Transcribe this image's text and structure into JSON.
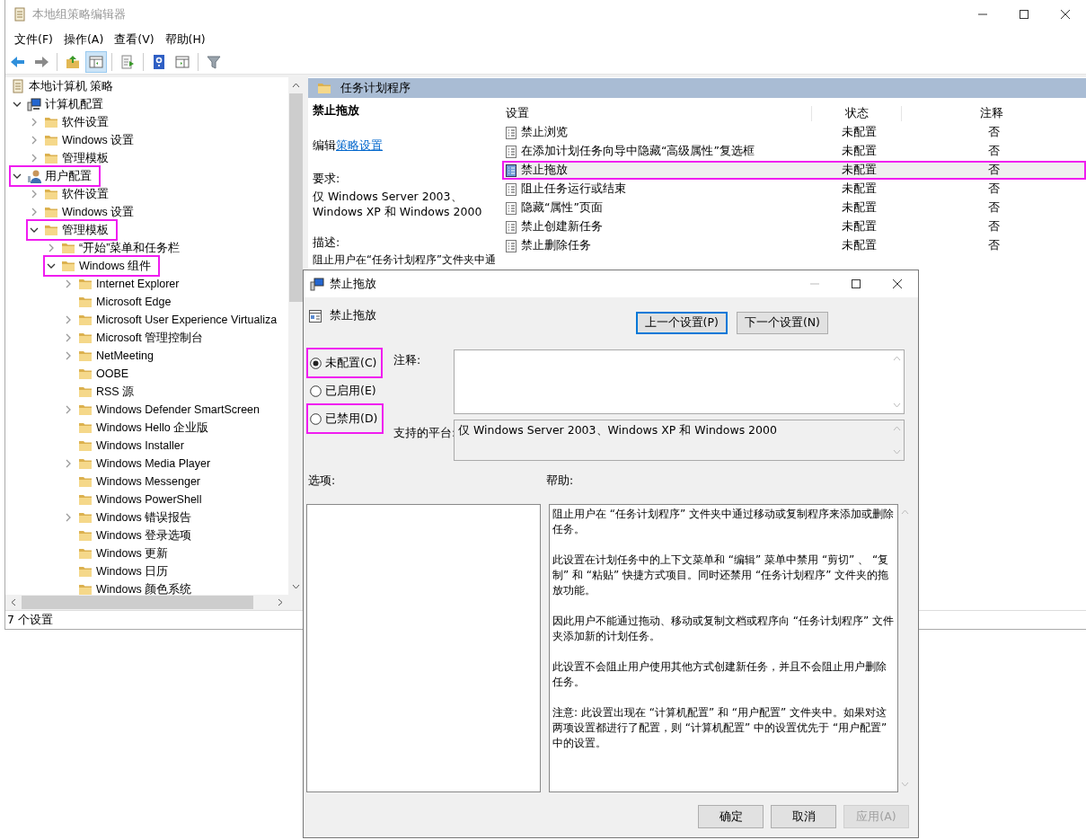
{
  "window": {
    "title": "本地组策略编辑器"
  },
  "menu": [
    "文件(F)",
    "操作(A)",
    "查看(V)",
    "帮助(H)"
  ],
  "toolbar": [
    [
      {
        "kind": "back",
        "pressed": false
      },
      {
        "kind": "forward",
        "pressed": false
      }
    ],
    [
      {
        "kind": "up",
        "pressed": false
      },
      {
        "kind": "tree",
        "pressed": true
      }
    ],
    [
      {
        "kind": "export",
        "pressed": false
      }
    ],
    [
      {
        "kind": "help",
        "pressed": false
      },
      {
        "kind": "view",
        "pressed": false
      }
    ],
    [
      {
        "kind": "filter",
        "pressed": false
      }
    ]
  ],
  "tree": {
    "label": "本地计算机 策略",
    "children": [
      {
        "label": "计算机配置",
        "kind": "computer",
        "expandable": true,
        "expanded": true,
        "highlighted": false,
        "children": [
          {
            "label": "软件设置",
            "kind": "folder",
            "expandable": true,
            "expanded": false,
            "highlighted": false
          },
          {
            "label": "Windows 设置",
            "kind": "folder",
            "expandable": true,
            "expanded": false,
            "highlighted": false
          },
          {
            "label": "管理模板",
            "kind": "folder",
            "expandable": true,
            "expanded": false,
            "highlighted": false
          }
        ]
      },
      {
        "label": "用户配置",
        "kind": "user",
        "expandable": true,
        "expanded": true,
        "highlighted": true,
        "children": [
          {
            "label": "软件设置",
            "kind": "folder",
            "expandable": true,
            "expanded": false,
            "highlighted": false
          },
          {
            "label": "Windows 设置",
            "kind": "folder",
            "expandable": true,
            "expanded": false,
            "highlighted": false
          },
          {
            "label": "管理模板",
            "kind": "folder",
            "expandable": true,
            "expanded": true,
            "highlighted": true,
            "children": [
              {
                "label": "“开始”菜单和任务栏",
                "kind": "folder",
                "expandable": true,
                "expanded": false,
                "highlighted": false
              },
              {
                "label": "Windows 组件",
                "kind": "folder",
                "expandable": true,
                "expanded": true,
                "highlighted": true,
                "children": [
                  {
                    "label": "Internet Explorer",
                    "kind": "folder",
                    "expandable": true,
                    "expanded": false,
                    "highlighted": false
                  },
                  {
                    "label": "Microsoft Edge",
                    "kind": "folder",
                    "expandable": false,
                    "highlighted": false
                  },
                  {
                    "label": "Microsoft User Experience Virtualiza",
                    "kind": "folder",
                    "expandable": true,
                    "expanded": false,
                    "highlighted": false
                  },
                  {
                    "label": "Microsoft 管理控制台",
                    "kind": "folder",
                    "expandable": true,
                    "expanded": false,
                    "highlighted": false
                  },
                  {
                    "label": "NetMeeting",
                    "kind": "folder",
                    "expandable": true,
                    "expanded": false,
                    "highlighted": false
                  },
                  {
                    "label": "OOBE",
                    "kind": "folder",
                    "expandable": false,
                    "highlighted": false
                  },
                  {
                    "label": "RSS 源",
                    "kind": "folder",
                    "expandable": false,
                    "highlighted": false
                  },
                  {
                    "label": "Windows Defender SmartScreen",
                    "kind": "folder",
                    "expandable": true,
                    "expanded": false,
                    "highlighted": false
                  },
                  {
                    "label": "Windows Hello 企业版",
                    "kind": "folder",
                    "expandable": false,
                    "highlighted": false
                  },
                  {
                    "label": "Windows Installer",
                    "kind": "folder",
                    "expandable": false,
                    "highlighted": false
                  },
                  {
                    "label": "Windows Media Player",
                    "kind": "folder",
                    "expandable": true,
                    "expanded": false,
                    "highlighted": false
                  },
                  {
                    "label": "Windows Messenger",
                    "kind": "folder",
                    "expandable": false,
                    "highlighted": false
                  },
                  {
                    "label": "Windows PowerShell",
                    "kind": "folder",
                    "expandable": false,
                    "highlighted": false
                  },
                  {
                    "label": "Windows 错误报告",
                    "kind": "folder",
                    "expandable": true,
                    "expanded": false,
                    "highlighted": false
                  },
                  {
                    "label": "Windows 登录选项",
                    "kind": "folder",
                    "expandable": false,
                    "highlighted": false
                  },
                  {
                    "label": "Windows 更新",
                    "kind": "folder",
                    "expandable": false,
                    "highlighted": false
                  },
                  {
                    "label": "Windows 日历",
                    "kind": "folder",
                    "expandable": false,
                    "highlighted": false
                  },
                  {
                    "label": "Windows 颜色系统",
                    "kind": "folder",
                    "expandable": false,
                    "highlighted": false
                  }
                ]
              }
            ]
          }
        ]
      }
    ]
  },
  "pane": {
    "header": "任务计划程序",
    "detail": {
      "title": "禁止拖放",
      "edit_prefix": "编辑",
      "edit_link": "策略设置",
      "requirements_label": "要求:",
      "requirements": "仅 Windows Server 2003、Windows XP 和 Windows 2000",
      "description_label": "描述:",
      "description": "阻止用户在“任务计划程序”文件夹中通"
    },
    "columns": [
      "设置",
      "状态",
      "注释"
    ],
    "rows": [
      {
        "setting": "禁止浏览",
        "state": "未配置",
        "comment": "否",
        "selected": false,
        "highlighted": false
      },
      {
        "setting": "在添加计划任务向导中隐藏“高级属性”复选框",
        "state": "未配置",
        "comment": "否",
        "selected": false,
        "highlighted": false
      },
      {
        "setting": "禁止拖放",
        "state": "未配置",
        "comment": "否",
        "selected": true,
        "highlighted": true
      },
      {
        "setting": "阻止任务运行或结束",
        "state": "未配置",
        "comment": "否",
        "selected": false,
        "highlighted": false
      },
      {
        "setting": "隐藏“属性”页面",
        "state": "未配置",
        "comment": "否",
        "selected": false,
        "highlighted": false
      },
      {
        "setting": "禁止创建新任务",
        "state": "未配置",
        "comment": "否",
        "selected": false,
        "highlighted": false
      },
      {
        "setting": "禁止删除任务",
        "state": "未配置",
        "comment": "否",
        "selected": false,
        "highlighted": false
      }
    ]
  },
  "status_bar": "7 个设置",
  "dialog": {
    "title": "禁止拖放",
    "heading": "禁止拖放",
    "nav_buttons": [
      {
        "label": "上一个设置(P)",
        "focused": true
      },
      {
        "label": "下一个设置(N)",
        "focused": false
      }
    ],
    "radios": [
      {
        "label": "未配置(C)",
        "selected": true,
        "highlighted": true
      },
      {
        "label": "已启用(E)",
        "selected": false,
        "highlighted": false
      },
      {
        "label": "已禁用(D)",
        "selected": false,
        "highlighted": true
      }
    ],
    "comment_label": "注释:",
    "platform_label": "支持的平台:",
    "platform": "仅 Windows Server 2003、Windows XP 和 Windows 2000",
    "options_label": "选项:",
    "help_label": "帮助:",
    "help": [
      "阻止用户在 “任务计划程序” 文件夹中通过移动或复制程序来添加或删除任务。",
      "此设置在计划任务中的上下文菜单和 “编辑” 菜单中禁用 “剪切” 、 “复制” 和 “粘贴” 快捷方式项目。同时还禁用 “任务计划程序” 文件夹的拖放功能。",
      "因此用户不能通过拖动、移动或复制文档或程序向 “任务计划程序” 文件夹添加新的计划任务。",
      "此设置不会阻止用户使用其他方式创建新任务，并且不会阻止用户删除任务。",
      "注意: 此设置出现在 “计算机配置” 和 “用户配置” 文件夹中。如果对这两项设置都进行了配置，则 “计算机配置” 中的设置优先于 “用户配置” 中的设置。"
    ],
    "buttons": [
      {
        "label": "确定",
        "disabled": false
      },
      {
        "label": "取消",
        "disabled": false
      },
      {
        "label": "应用(A)",
        "disabled": true
      }
    ]
  }
}
